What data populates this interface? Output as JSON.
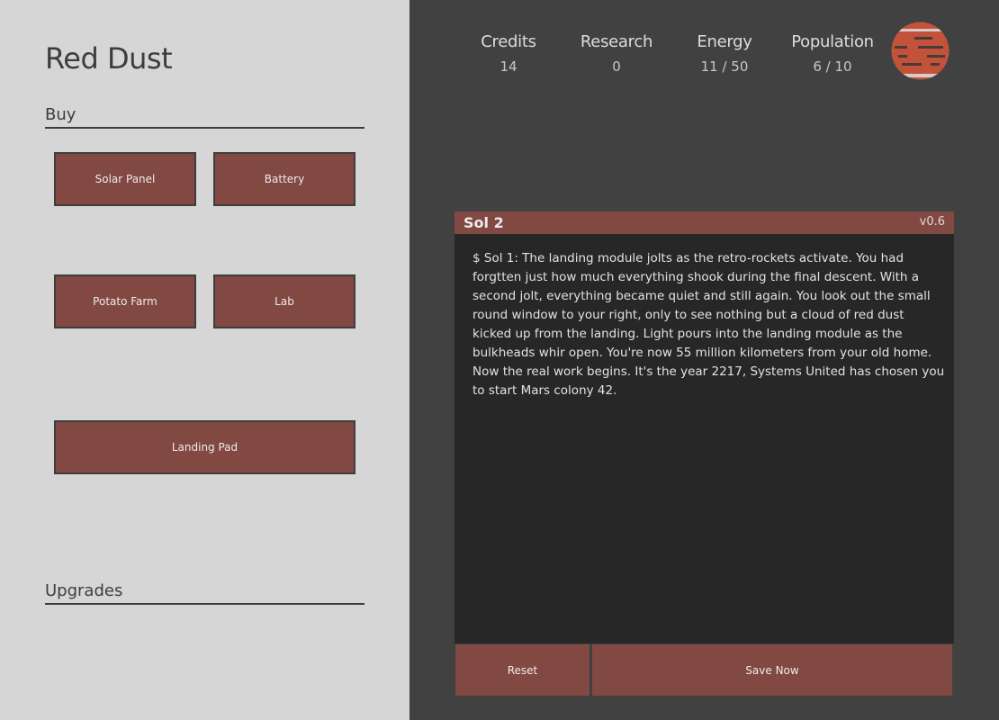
{
  "app": {
    "title": "Red Dust"
  },
  "buy": {
    "heading": "Buy",
    "items": [
      {
        "label": "Solar Panel"
      },
      {
        "label": "Battery"
      },
      {
        "label": "Potato Farm"
      },
      {
        "label": "Lab"
      },
      {
        "label": "Landing Pad"
      }
    ]
  },
  "upgrades": {
    "heading": "Upgrades"
  },
  "stats": [
    {
      "label": "Credits",
      "value": "14"
    },
    {
      "label": "Research",
      "value": "0"
    },
    {
      "label": "Energy",
      "value": "11 / 50"
    },
    {
      "label": "Population",
      "value": "6 / 10"
    }
  ],
  "planet": {
    "icon": "mars-planet-icon",
    "color": "#c2533a"
  },
  "console": {
    "title": "Sol 2",
    "version": "v0.6",
    "log": "$ Sol 1: The landing module jolts as the retro-rockets activate. You had forgtten just how much everything shook during the final descent. With a second jolt, everything became quiet and still again. You look out the small round window to your right, only to see nothing but a cloud of red dust kicked up from the landing. Light pours into the landing module as the bulkheads whir open. You're now 55 million kilometers from your old home. Now the real work begins. It's the year 2217, Systems United has chosen you to start Mars colony 42."
  },
  "actions": {
    "reset_label": "Reset",
    "save_label": "Save Now"
  },
  "colors": {
    "accent": "#824842",
    "left_bg": "#d6d6d6",
    "right_bg": "#414141",
    "console_bg": "#272727"
  }
}
